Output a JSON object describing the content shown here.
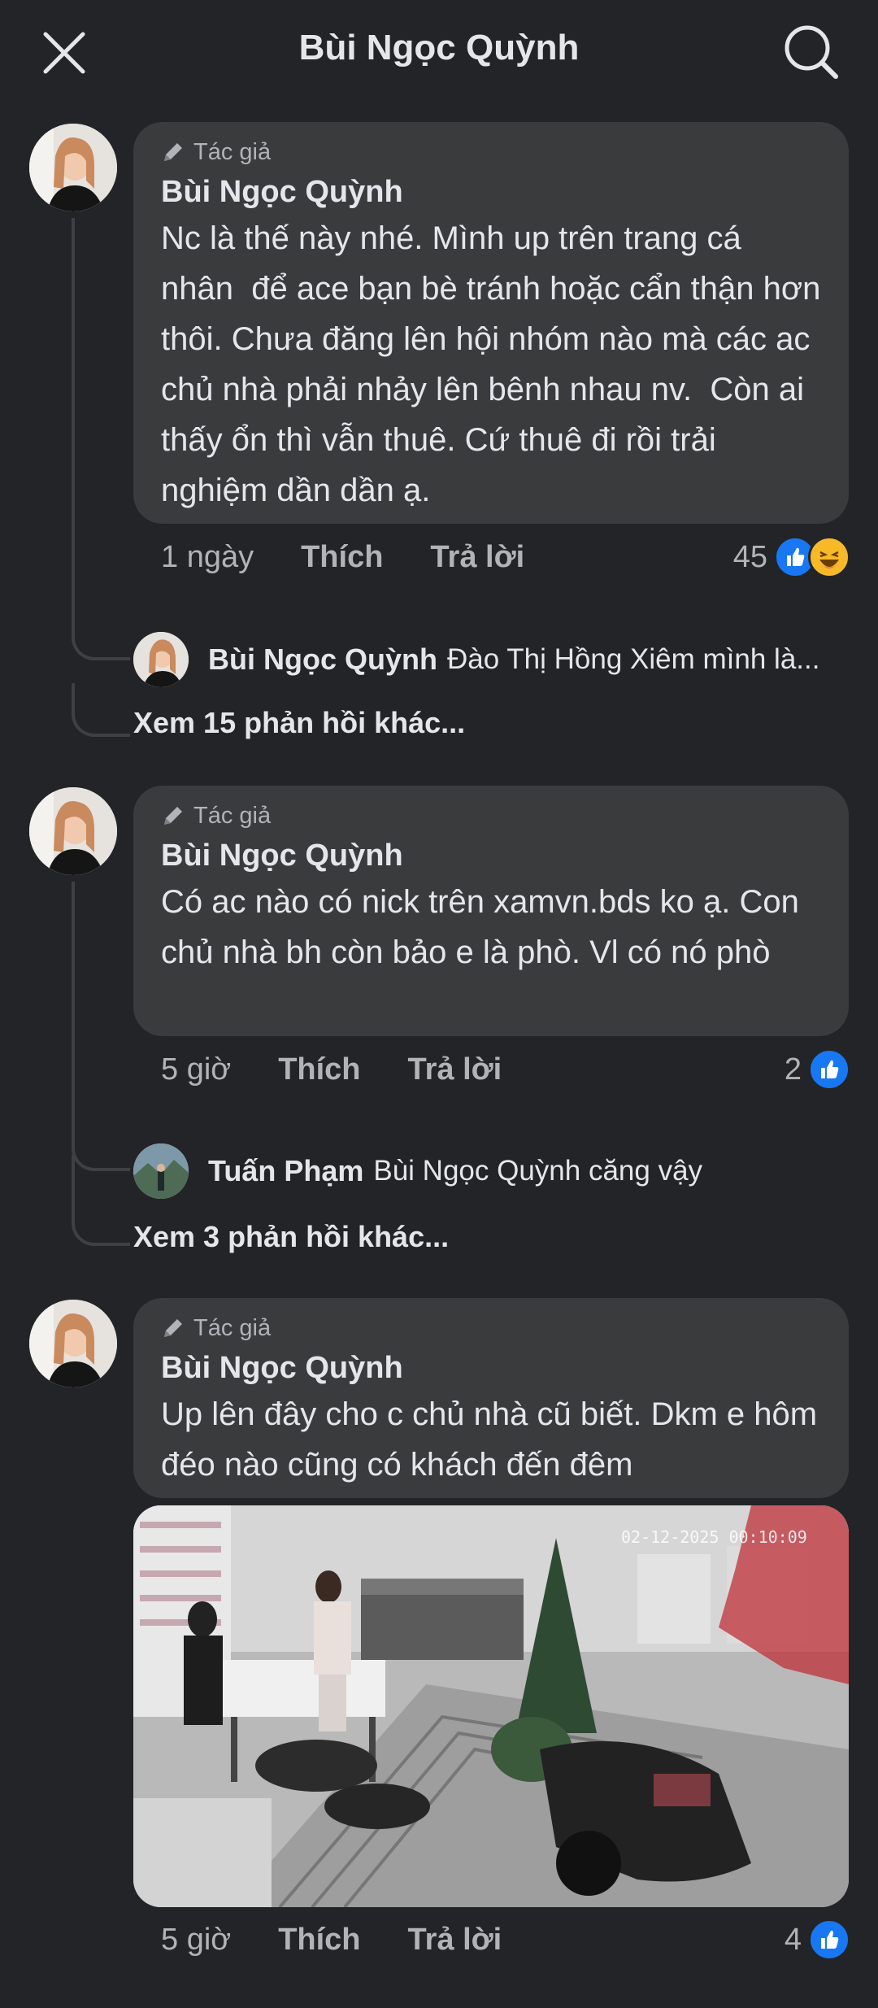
{
  "header": {
    "title": "Bùi Ngọc Quỳnh",
    "close_icon": "close-icon",
    "search_icon": "search-icon"
  },
  "comments": [
    {
      "badge": "Tác giả",
      "author": "Bùi Ngọc Quỳnh",
      "text": "Nc là thế này nhé. Mình up trên trang cá nhân  để ace bạn bè tránh hoặc cẩn thận hơn thôi. Chưa đăng lên hội nhóm nào mà các ac chủ nhà phải nhảy lên bênh nhau nv.  Còn ai thấy ổn thì vẫn thuê. Cứ thuê đi rồi trải nghiệm dần dần ạ.",
      "time": "1 ngày",
      "like_label": "Thích",
      "reply_label": "Trả lời",
      "reaction_count": "45",
      "reactions": [
        "like-icon",
        "haha-icon"
      ],
      "reply_preview": {
        "name": "Bùi Ngọc Quỳnh",
        "text": "Đào Thị Hồng Xiêm mình là..."
      },
      "more_replies": "Xem 15 phản hồi khác..."
    },
    {
      "badge": "Tác giả",
      "author": "Bùi Ngọc Quỳnh",
      "text": "Có ac nào có nick trên xamvn.bds ko ạ. Con chủ nhà bh còn bảo e là phò. Vl có nó phò",
      "time": "5 giờ",
      "like_label": "Thích",
      "reply_label": "Trả lời",
      "reaction_count": "2",
      "reactions": [
        "like-icon"
      ],
      "reply_preview": {
        "name": "Tuấn Phạm",
        "text": "Bùi Ngọc Quỳnh căng vậy"
      },
      "more_replies": "Xem 3 phản hồi khác..."
    },
    {
      "badge": "Tác giả",
      "author": "Bùi Ngọc Quỳnh",
      "text": "Up lên đây cho c chủ nhà cũ biết. Dkm e hôm đéo nào cũng có khách đến đêm",
      "photo_timestamp": "02-12-2025 00:10:09",
      "time": "5 giờ",
      "like_label": "Thích",
      "reply_label": "Trả lời",
      "reaction_count": "4",
      "reactions": [
        "like-icon"
      ]
    }
  ],
  "colors": {
    "background": "#232427",
    "bubble": "#3a3b3c",
    "text": "#e4e6eb",
    "muted": "#b0b3b8",
    "like_blue": "#1877f2",
    "haha_yellow": "#f7b928"
  }
}
